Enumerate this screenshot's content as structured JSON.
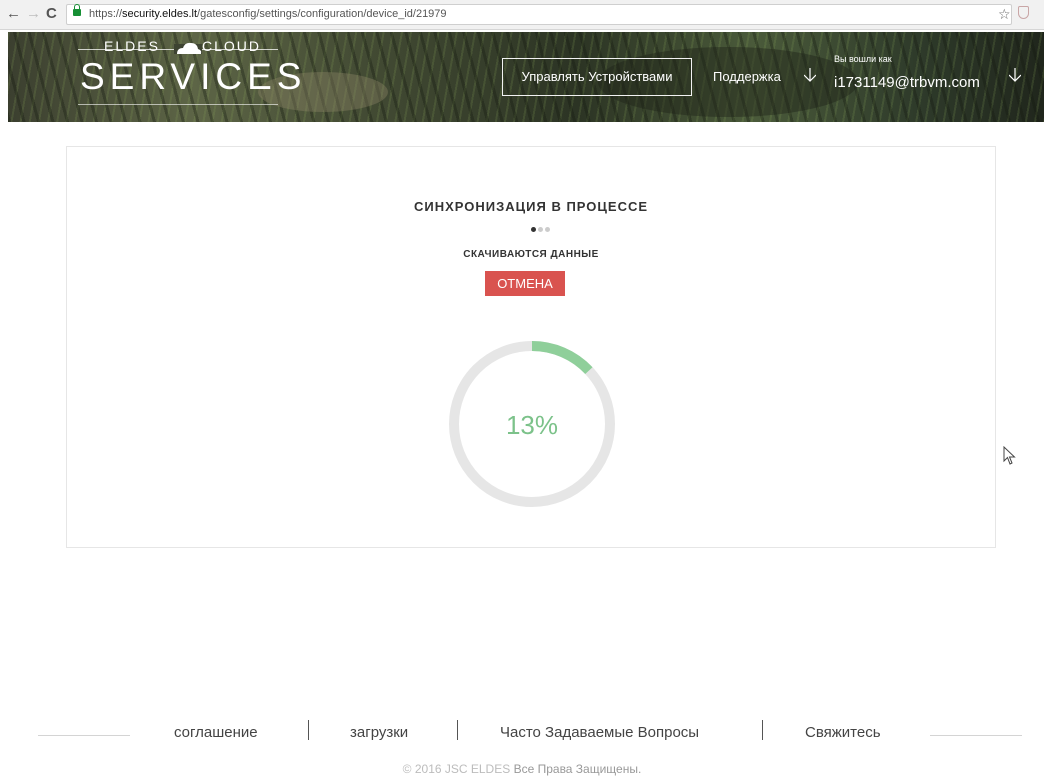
{
  "browser": {
    "url_prefix": "https://",
    "url_domain": "security.eldes.lt",
    "url_path": "/gatesconfig/settings/configuration/device_id/21979",
    "back_icon": "arrow-left-icon",
    "forward_icon": "arrow-right-icon",
    "reload_icon": "reload-icon",
    "bookmark_icon": "star-icon"
  },
  "header": {
    "logo_top_left": "ELDES",
    "logo_top_right": "CLOUD",
    "logo_main": "SERVICES",
    "manage_devices_label": "Управлять Устройствами",
    "support_label": "Поддержка",
    "logged_in_label": "Вы вошли как",
    "user_email": "i1731149@trbvm.com"
  },
  "sync": {
    "title": "СИНХРОНИЗАЦИЯ В ПРОЦЕССЕ",
    "status": "СКАЧИВАЮТСЯ ДАННЫЕ",
    "cancel_label": "ОТМЕНА",
    "progress_percent": 13,
    "progress_text": "13%",
    "active_dot": 1
  },
  "colors": {
    "progress_fill": "#8fcf9a",
    "progress_track": "#e6e6e6",
    "progress_text": "#7cc28a",
    "cancel_bg": "#d9534f"
  },
  "footer": {
    "links": [
      "соглашение",
      "загрузки",
      "Часто Задаваемые Вопросы",
      "Свяжитесь"
    ],
    "copyright_prefix": "© 2016 JSC ELDES",
    "copyright_suffix": "Все Права Защищены."
  }
}
